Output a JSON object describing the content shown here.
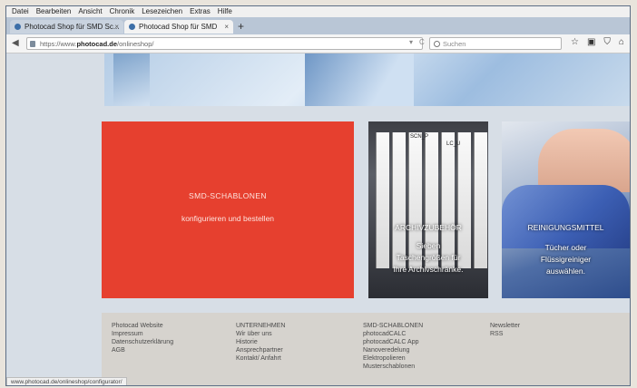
{
  "menu": [
    "Datei",
    "Bearbeiten",
    "Ansicht",
    "Chronik",
    "Lesezeichen",
    "Extras",
    "Hilfe"
  ],
  "tabs": [
    {
      "label": "Photocad Shop für SMD Sc...",
      "close": "×"
    },
    {
      "label": "Photocad Shop für SMD Sc...",
      "close": "×"
    }
  ],
  "new_tab": "+",
  "address": {
    "prefix": "https://www.",
    "domain": "photocad.de",
    "path": "/onlineshop/",
    "reload": "C"
  },
  "search": {
    "placeholder": "Suchen"
  },
  "toolbar_icons": [
    "star-icon",
    "clipboard-icon",
    "shield-icon",
    "home-icon"
  ],
  "tiles": {
    "smd": {
      "title": "SMD-SCHABLONEN",
      "subtitle": "konfigurieren und bestellen",
      "color": "#e6402f"
    },
    "archiv": {
      "title": "ARCHIVZUBEHÖR",
      "lines": [
        "Sieben",
        "Taschengrößen für",
        "Ihre Archivschränke."
      ],
      "folder_labels": [
        "SCN_P",
        "LC_U"
      ]
    },
    "reinigung": {
      "title": "REINIGUNGSMITTEL",
      "lines": [
        "Tücher oder",
        "Flüssigreiniger",
        "auswählen."
      ]
    }
  },
  "footer": {
    "col1": [
      "Photocad Website",
      "Impressum",
      "Datenschutzerklärung",
      "AGB"
    ],
    "col2": [
      "UNTERNEHMEN",
      "Wir über uns",
      "Historie",
      "Ansprechpartner",
      "Kontakt/ Anfahrt"
    ],
    "col3": [
      "SMD-SCHABLONEN",
      "photocadCALC",
      "photocadCALC App",
      "Nanoveredelung",
      "Elektropolieren",
      "Musterschablonen"
    ],
    "col4": [
      "Newsletter",
      "RSS"
    ]
  },
  "status_url": "www.photocad.de/onlineshop/configurator/"
}
